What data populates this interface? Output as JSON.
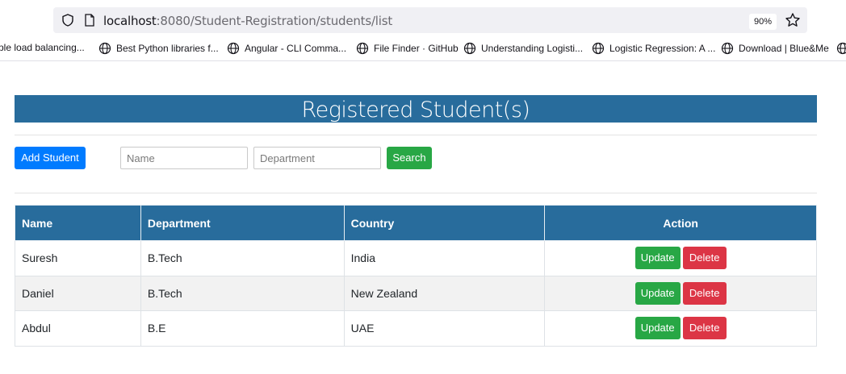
{
  "browser": {
    "url_host": "localhost",
    "url_path": ":8080/Student-Registration/students/list",
    "zoom": "90%",
    "bookmarks": [
      "ple load balancing...",
      "Best Python libraries f...",
      "Angular - CLI Comma...",
      "File Finder · GitHub",
      "Understanding Logisti...",
      "Logistic Regression: A ...",
      "Download | Blue&Me"
    ]
  },
  "page": {
    "title": "Registered Student(s)",
    "add_button": "Add Student",
    "name_placeholder": "Name",
    "department_placeholder": "Department",
    "search_button": "Search"
  },
  "table": {
    "headers": [
      "Name",
      "Department",
      "Country",
      "Action"
    ],
    "update_label": "Update",
    "delete_label": "Delete",
    "rows": [
      {
        "name": "Suresh",
        "department": "B.Tech",
        "country": "India"
      },
      {
        "name": "Daniel",
        "department": "B.Tech",
        "country": "New Zealand"
      },
      {
        "name": "Abdul",
        "department": "B.E",
        "country": "UAE"
      }
    ]
  },
  "colors": {
    "header_bg": "#286c9c",
    "primary": "#007bff",
    "success": "#28a745",
    "danger": "#dc3545"
  }
}
